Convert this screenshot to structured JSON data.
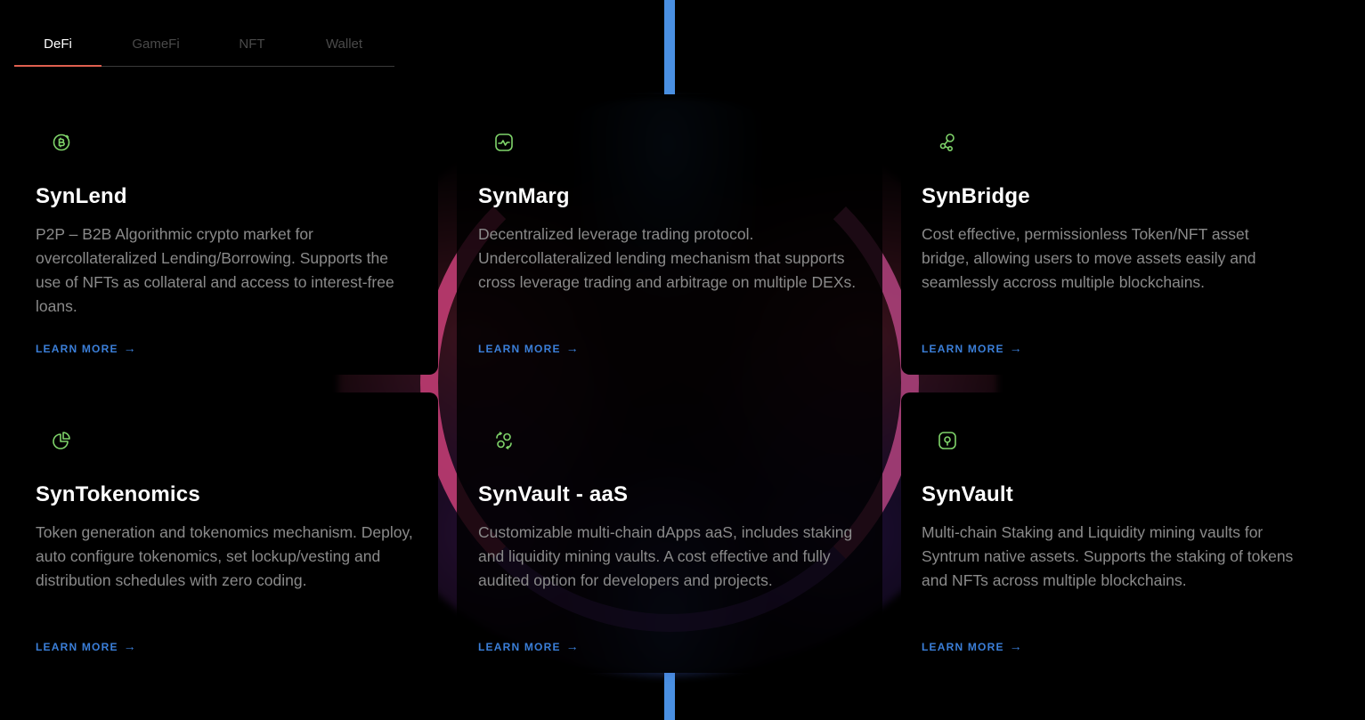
{
  "tabs": [
    {
      "label": "DeFi",
      "active": true
    },
    {
      "label": "GameFi",
      "active": false
    },
    {
      "label": "NFT",
      "active": false
    },
    {
      "label": "Wallet",
      "active": false
    }
  ],
  "colors": {
    "accent_tab_underline": "#e0604f",
    "link": "#3b7fd9",
    "icon": "#7fd46a",
    "title": "#ffffff",
    "body_text": "#8a8a8a",
    "background": "#000000"
  },
  "learn_more_label": "LEARN MORE",
  "learn_more_arrow": "→",
  "cards": [
    {
      "icon": "bitcoin-coin-icon",
      "title": "SynLend",
      "description": "P2P – B2B Algorithmic crypto market for overcollateralized Lending/Borrowing. Supports the use of NFTs as collateral and access to interest-free loans."
    },
    {
      "icon": "activity-chart-icon",
      "title": "SynMarg",
      "description": "Decentralized leverage trading protocol. Undercollateralized lending mechanism that supports cross leverage trading and arbitrage on multiple DEXs."
    },
    {
      "icon": "share-nodes-icon",
      "title": "SynBridge",
      "description": "Cost effective, permissionless Token/NFT asset bridge, allowing users to move assets easily and seamlessly accross multiple blockchains."
    },
    {
      "icon": "pie-chart-icon",
      "title": "SynTokenomics",
      "description": "Token generation and tokenomics mechanism. Deploy, auto configure tokenomics, set lockup/vesting and distribution schedules with zero coding."
    },
    {
      "icon": "exchange-coins-icon",
      "title": "SynVault - aaS",
      "description": "Customizable multi-chain dApps aaS, includes staking and liquidity mining vaults. A cost effective and fully audited option for developers and projects."
    },
    {
      "icon": "vault-lock-icon",
      "title": "SynVault",
      "description": "Multi-chain Staking and Liquidity mining vaults for Syntrum native assets. Supports the staking of tokens and NFTs across multiple blockchains."
    }
  ]
}
